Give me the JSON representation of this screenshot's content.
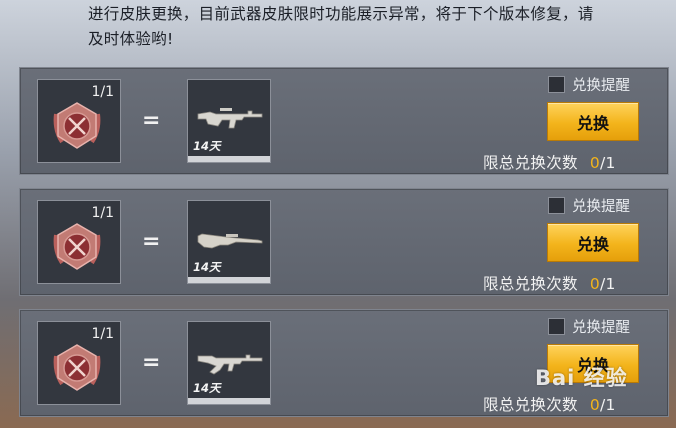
{
  "notice": {
    "line1": "进行皮肤更换，目前武器皮肤限时功能展示异常，将于下个版本修复，请",
    "line2": "及时体验哟!"
  },
  "exchange_items": [
    {
      "source_count": "1/1",
      "equals": "=",
      "reward_duration": "14天",
      "weapon_icon": "assault-rifle-m16-icon",
      "reminder_label": "兑换提醒",
      "exchange_button": "兑换",
      "limit_label": "限总兑换次数",
      "limit_used": "0",
      "limit_total": "/1"
    },
    {
      "source_count": "1/1",
      "equals": "=",
      "reward_duration": "14天",
      "weapon_icon": "bolt-action-rifle-icon",
      "reminder_label": "兑换提醒",
      "exchange_button": "兑换",
      "limit_label": "限总兑换次数",
      "limit_used": "0",
      "limit_total": "/1"
    },
    {
      "source_count": "1/1",
      "equals": "=",
      "reward_duration": "14天",
      "weapon_icon": "assault-rifle-ak-icon",
      "reminder_label": "兑换提醒",
      "exchange_button": "兑换",
      "limit_label": "限总兑换次数",
      "limit_used": "0",
      "limit_total": "/1"
    }
  ],
  "medal_icon": "crossed-rifles-medal-icon",
  "watermark": "Bai 经验",
  "colors": {
    "accent": "#f3b41b",
    "panel": "#62676f",
    "slot": "#33373f"
  }
}
